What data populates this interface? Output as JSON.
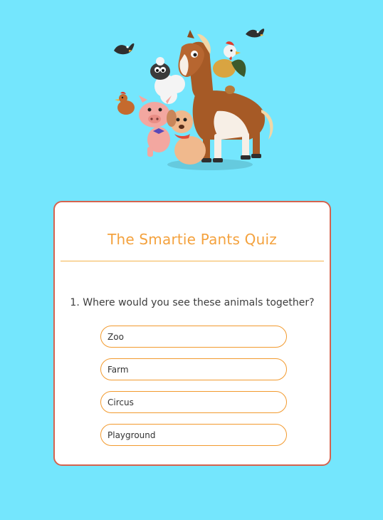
{
  "quiz": {
    "title": "The Smartie Pants Quiz",
    "question": "1. Where would you see these animals together?",
    "answers": [
      {
        "label": "Zoo"
      },
      {
        "label": "Farm"
      },
      {
        "label": "Circus"
      },
      {
        "label": "Playground"
      }
    ]
  },
  "colors": {
    "background": "#74e6fd",
    "card_border": "#d5634e",
    "title": "#f4a23e",
    "answer_border": "#f29a2e"
  },
  "icons": {
    "hero": "farm-animals-illustration"
  }
}
